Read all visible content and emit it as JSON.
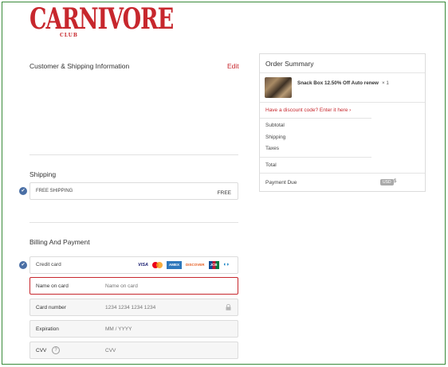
{
  "brand": {
    "logo_main": "CARNIVORE",
    "logo_sub": "CLUB"
  },
  "customer_section": {
    "title": "Customer & Shipping Information",
    "edit_label": "Edit"
  },
  "shipping": {
    "title": "Shipping",
    "method": "FREE SHIPPING",
    "price": "FREE"
  },
  "billing": {
    "title": "Billing And Payment",
    "method_label": "Credit card",
    "cards": [
      "VISA",
      "",
      "AMEX",
      "DISCOVER",
      "JCB",
      ""
    ],
    "fields": [
      {
        "label": "Name on card",
        "placeholder": "Name on card"
      },
      {
        "label": "Card number",
        "placeholder": "1234 1234 1234 1234"
      },
      {
        "label": "Expiration",
        "placeholder": "MM / YYYY"
      },
      {
        "label": "CVV",
        "placeholder": "CVV",
        "help": "?"
      }
    ]
  },
  "order_summary": {
    "title": "Order Summary",
    "product_name": "Snack Box 12.50% Off Auto renew",
    "product_qty": "× 1",
    "discount_link": "Have a discount code? Enter it here  ›",
    "rows": [
      "Subtotal",
      "Shipping",
      "Taxes",
      "Total"
    ],
    "payment_due_label": "Payment Due",
    "currency": "USD",
    "currency_tail": "$"
  },
  "colors": {
    "accent": "#c7272d",
    "check": "#4a6fa5",
    "frame": "#3a8a3a"
  }
}
